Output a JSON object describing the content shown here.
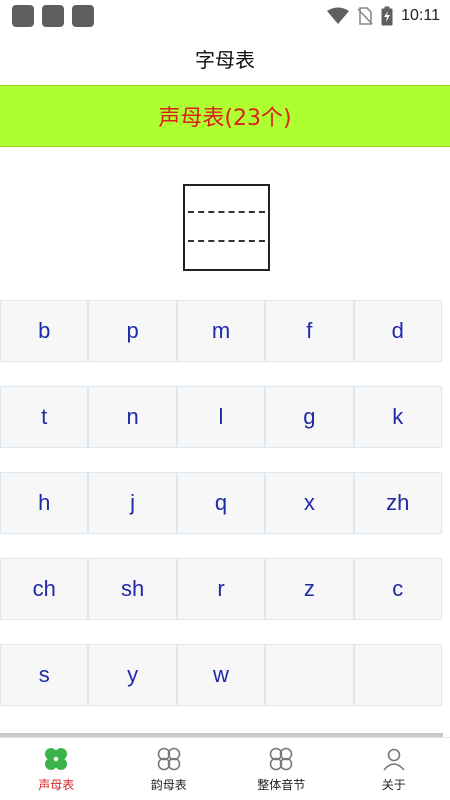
{
  "status_bar": {
    "time": "10:11"
  },
  "app_bar": {
    "title": "字母表"
  },
  "banner": {
    "text": "声母表(23个)"
  },
  "letters": [
    [
      "b",
      "p",
      "m",
      "f",
      "d"
    ],
    [
      "t",
      "n",
      "l",
      "g",
      "k"
    ],
    [
      "h",
      "j",
      "q",
      "x",
      "zh"
    ],
    [
      "ch",
      "sh",
      "r",
      "z",
      "c"
    ],
    [
      "s",
      "y",
      "w",
      "",
      ""
    ]
  ],
  "bottom_nav": [
    {
      "label": "声母表",
      "icon": "clover-icon",
      "active": true
    },
    {
      "label": "韵母表",
      "icon": "four-circles-icon",
      "active": false
    },
    {
      "label": "整体音节",
      "icon": "four-circles-icon",
      "active": false
    },
    {
      "label": "关于",
      "icon": "person-icon",
      "active": false
    }
  ],
  "colors": {
    "banner_bg": "#adff2f",
    "banner_text": "#e11c1c",
    "letter_text": "#1f2aa8",
    "nav_active": "#d72424",
    "nav_active_icon": "#3cb44a"
  }
}
